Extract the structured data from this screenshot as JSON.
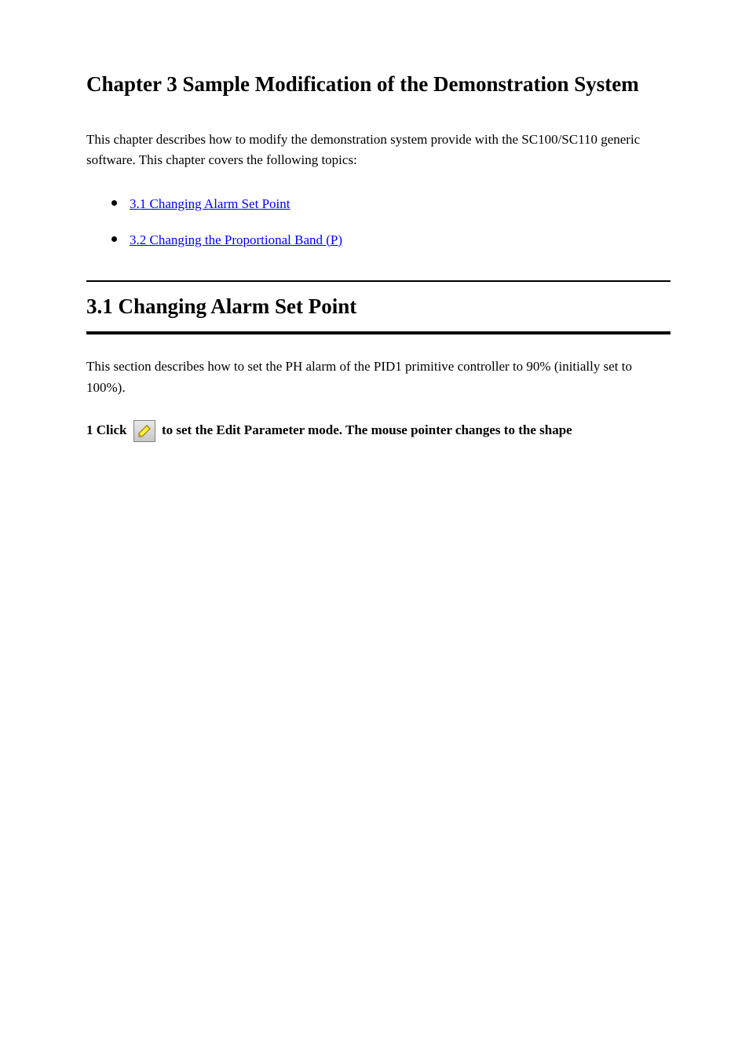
{
  "chapter_title": "Chapter 3 Sample Modification of the Demonstration System",
  "intro_para": "This chapter describes how to modify the demonstration system provide with the SC100/SC110 generic software. This chapter covers the following topics:",
  "links": {
    "link1": "3.1 Changing Alarm Set Point",
    "link2": "3.2 Changing the Proportional Band (P)"
  },
  "section": {
    "title": "3.1 Changing Alarm Set Point",
    "para1": "This section describes how to set the PH alarm of the PID1 primitive controller to 90% (initially set to 100%).",
    "step_label": "1 Click  ",
    "step_text_after_icon": "  to set the Edit Parameter mode. The mouse pointer changes to the shape"
  }
}
